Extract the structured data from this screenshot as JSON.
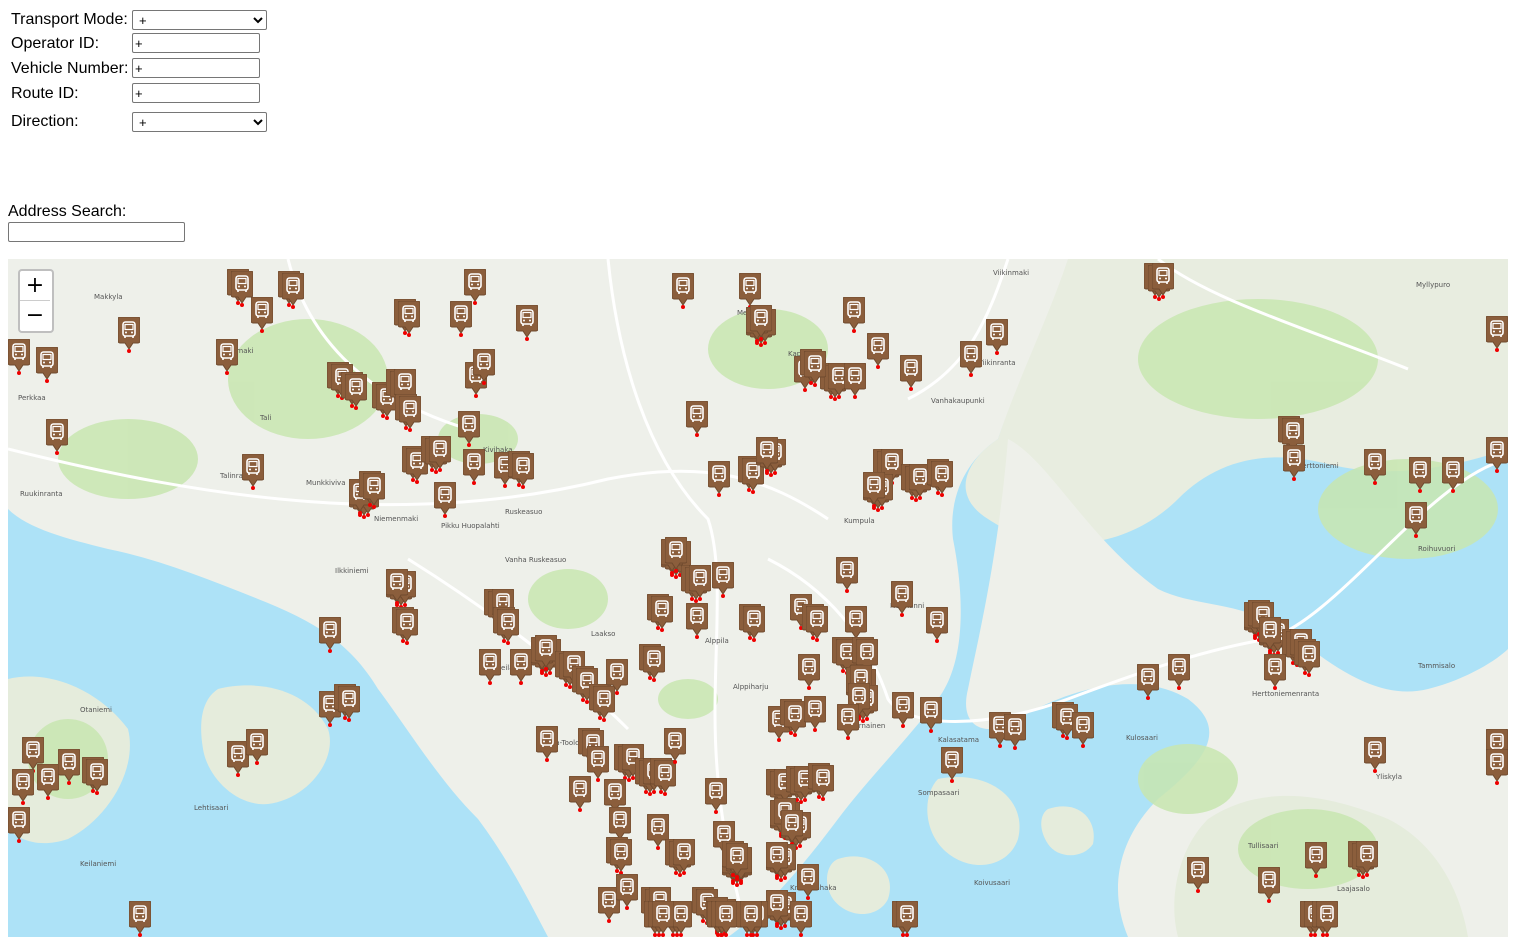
{
  "filters": {
    "transport_mode": {
      "label": "Transport Mode:",
      "value": "+"
    },
    "operator_id": {
      "label": "Operator ID:",
      "value": "+"
    },
    "vehicle_number": {
      "label": "Vehicle Number:",
      "value": "+"
    },
    "route_id": {
      "label": "Route ID:",
      "value": "+"
    },
    "direction": {
      "label": "Direction:",
      "value": "+"
    }
  },
  "address_search": {
    "label": "Address Search:",
    "value": ""
  },
  "map": {
    "zoom_in_label": "+",
    "zoom_out_label": "−",
    "colors": {
      "water": "#ade2f7",
      "land": "#f2efe9",
      "park": "#c8e6b0",
      "marker": "#8b5e3c",
      "marker_dot": "#e00000"
    },
    "places": [
      "Makkyla",
      "Pajamaki",
      "Perkkaa",
      "Tali",
      "Talinranta",
      "Munkkiviva",
      "Ruukinranta",
      "Niemenmaki",
      "Pikku Huopalahti",
      "Ruskeasuo",
      "Vanha Ruskeasuo",
      "Laakso",
      "Ilkkiniemi",
      "Meilahti",
      "Otaniemi",
      "Lehtisaari",
      "Keilaniemi",
      "Taka-Toolo",
      "Alppila",
      "Alppiharju",
      "Kumpula",
      "Hermanni",
      "Sompasaari",
      "Kruununhaka",
      "Kulosaari",
      "Herttoniemi",
      "Herttoniemenranta",
      "Roihuvuori",
      "Tammisalo",
      "Yliskyla",
      "Laajasalo",
      "Tullisaari",
      "Vanhakaupunki",
      "Viikinranta",
      "Viikinmaki",
      "Kapyla",
      "Metsala",
      "Kivihaka",
      "Sornainen",
      "Kalasatama",
      "Myllypuro",
      "Koivusaari"
    ],
    "vehicle_icon": "bus-icon",
    "vehicle_count": 206
  }
}
